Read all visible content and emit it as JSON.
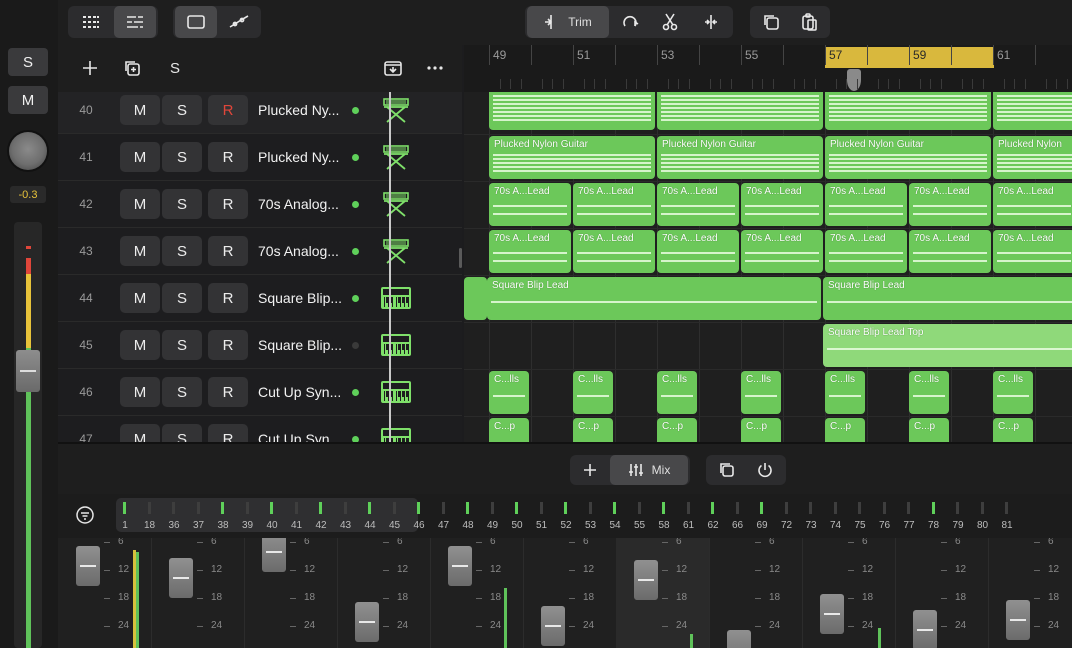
{
  "left_strip": {
    "solo_label": "S",
    "mute_label": "M",
    "knob_value": "-0.3"
  },
  "toolbar": {
    "trim_label": "Trim"
  },
  "tracks_header": {
    "solo_label": "S"
  },
  "tracks": [
    {
      "num": "40",
      "mute": "M",
      "solo": "S",
      "rec": "R",
      "name": "Plucked Ny...",
      "active": true,
      "instrument": "stand-keyboard"
    },
    {
      "num": "41",
      "mute": "M",
      "solo": "S",
      "rec": "R",
      "name": "Plucked Ny...",
      "active": true,
      "instrument": "stand-keyboard"
    },
    {
      "num": "42",
      "mute": "M",
      "solo": "S",
      "rec": "R",
      "name": "70s Analog...",
      "active": true,
      "instrument": "stand-keyboard"
    },
    {
      "num": "43",
      "mute": "M",
      "solo": "S",
      "rec": "R",
      "name": "70s Analog...",
      "active": true,
      "instrument": "stand-keyboard"
    },
    {
      "num": "44",
      "mute": "M",
      "solo": "S",
      "rec": "R",
      "name": "Square Blip...",
      "active": true,
      "instrument": "synth-keyboard"
    },
    {
      "num": "45",
      "mute": "M",
      "solo": "S",
      "rec": "R",
      "name": "Square Blip...",
      "active": false,
      "instrument": "synth-keyboard"
    },
    {
      "num": "46",
      "mute": "M",
      "solo": "S",
      "rec": "R",
      "name": "Cut Up Syn...",
      "active": true,
      "instrument": "synth-keyboard"
    },
    {
      "num": "47",
      "mute": "M",
      "solo": "S",
      "rec": "R",
      "name": "Cut Up Syn...",
      "active": true,
      "instrument": "synth-keyboard"
    }
  ],
  "ruler": {
    "bars": [
      "49",
      "51",
      "53",
      "55",
      "57",
      "59",
      "61"
    ],
    "cycle_bars": [
      "57",
      "59"
    ]
  },
  "regions": {
    "row40": [],
    "row41": [
      "Plucked Nylon Guitar",
      "Plucked Nylon Guitar",
      "Plucked Nylon Guitar",
      "Plucked Nylon"
    ],
    "row42": [
      "70s A...Lead",
      "70s A...Lead",
      "70s A...Lead",
      "70s A...Lead",
      "70s A...Lead",
      "70s A...Lead",
      "70s A...Lead"
    ],
    "row43": [
      "70s A...Lead",
      "70s A...Lead",
      "70s A...Lead",
      "70s A...Lead",
      "70s A...Lead",
      "70s A...Lead",
      "70s A...Lead"
    ],
    "row44": [
      "Square Blip Lead",
      "Square Blip Lead"
    ],
    "row45": [
      "Square Blip Lead Top"
    ],
    "row46": [
      "C...lls",
      "C...lls",
      "C...lls",
      "C...lls",
      "C...lls",
      "C...lls",
      "C...lls"
    ],
    "row47": [
      "C...p",
      "C...p",
      "C...p",
      "C...p",
      "C...p",
      "C...p",
      "C...p"
    ]
  },
  "mixer": {
    "mix_label": "Mix",
    "channels": [
      "1",
      "18",
      "36",
      "37",
      "38",
      "39",
      "40",
      "41",
      "42",
      "43",
      "44",
      "45",
      "46",
      "47",
      "48",
      "49",
      "50",
      "51",
      "52",
      "53",
      "54",
      "55",
      "58",
      "61",
      "62",
      "66",
      "69",
      "72",
      "73",
      "74",
      "75",
      "76",
      "77",
      "78",
      "79",
      "80",
      "81"
    ],
    "scale_marks": [
      "6",
      "12",
      "18",
      "24"
    ]
  },
  "colors": {
    "region_green": "#6cc85a",
    "region_light": "#8fd97a",
    "cycle_yellow": "#d9b83d",
    "meter_green": "#5fc25a",
    "knob_value": "#e8c33a"
  }
}
